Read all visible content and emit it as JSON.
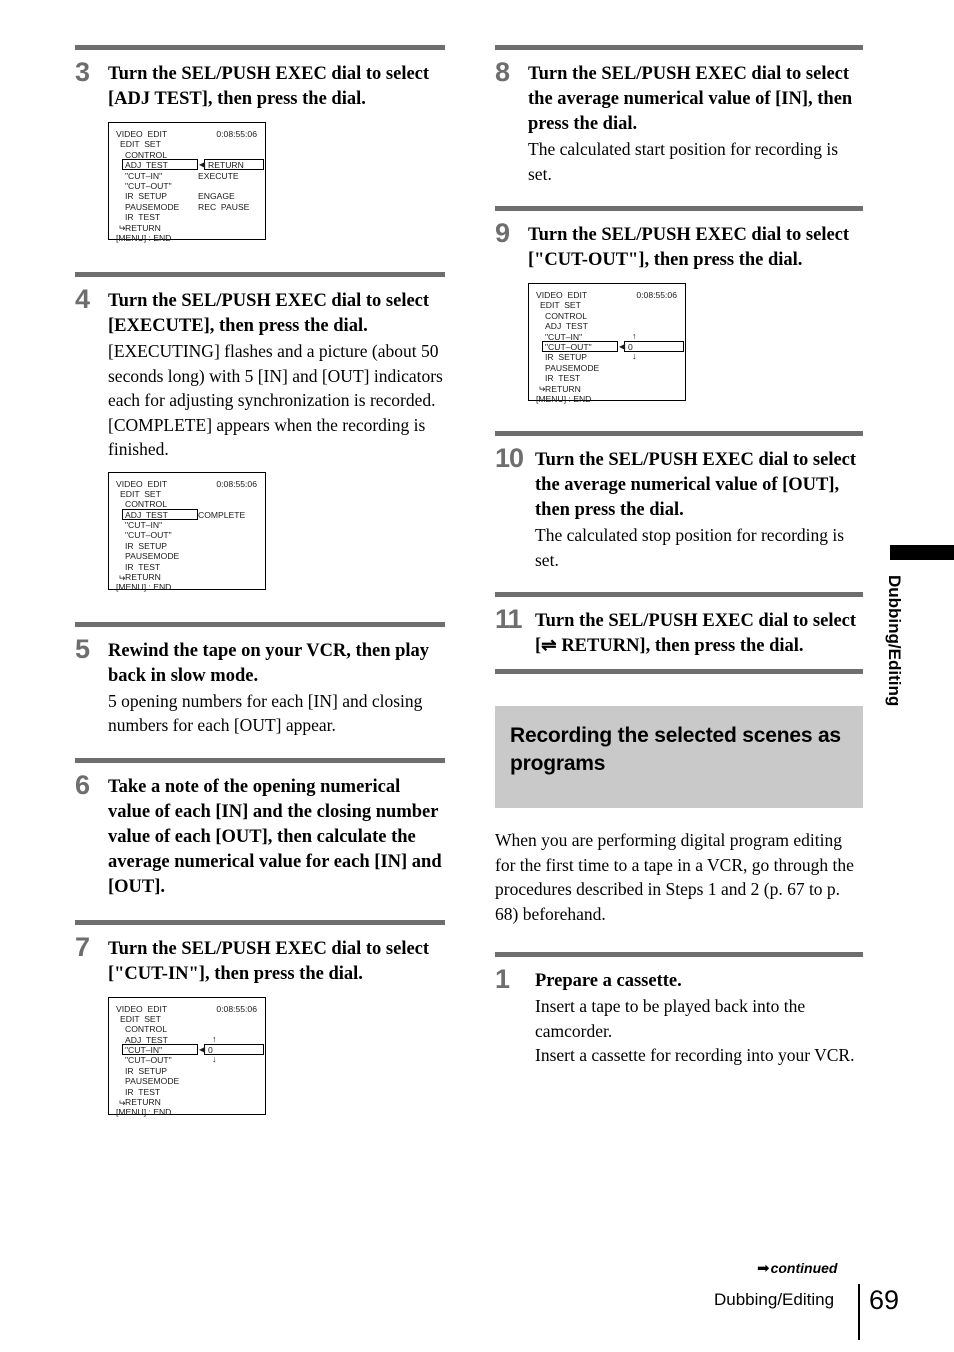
{
  "page": {
    "footer_section": "Dubbing/Editing",
    "page_number": "69",
    "continued_label": "continued",
    "continued_arrow": "➡",
    "side_tab_label": "Dubbing/Editing"
  },
  "left_column": {
    "steps": [
      {
        "number": "3",
        "title": "Turn the SEL/PUSH EXEC dial to select [ADJ TEST], then press the dial.",
        "body": ""
      },
      {
        "number": "4",
        "title": "Turn the SEL/PUSH EXEC dial to select [EXECUTE], then press the dial.",
        "body": "[EXECUTING] flashes and a picture (about 50 seconds long) with 5 [IN] and [OUT] indicators each for adjusting synchronization is recorded. [COMPLETE] appears when the recording is finished."
      },
      {
        "number": "5",
        "title": "Rewind the tape on your VCR, then play back in slow mode.",
        "body": "5 opening numbers for each [IN] and closing numbers for each [OUT] appear."
      },
      {
        "number": "6",
        "title": "Take a note of the opening numerical value of each [IN] and the closing number value of each [OUT], then calculate the average numerical value for each [IN] and [OUT].",
        "body": ""
      },
      {
        "number": "7",
        "title": "Turn the SEL/PUSH EXEC dial to select [\"CUT-IN\"], then press the dial.",
        "body": ""
      }
    ]
  },
  "right_column": {
    "steps": [
      {
        "number": "8",
        "title": "Turn the SEL/PUSH EXEC dial to select the average numerical value of [IN], then press the dial.",
        "body": "The calculated start position for recording is set."
      },
      {
        "number": "9",
        "title": "Turn the SEL/PUSH EXEC dial to select [\"CUT-OUT\"], then press the dial.",
        "body": ""
      },
      {
        "number": "10",
        "title": "Turn the SEL/PUSH EXEC dial to select the average numerical value of [OUT], then press the dial.",
        "body": "The calculated stop position for recording is set."
      },
      {
        "number": "11",
        "title_part1": "Turn the SEL/PUSH EXEC dial to select [",
        "return_glyph": "⇌",
        "title_part2": " RETURN], then press the dial.",
        "body": ""
      }
    ],
    "section": {
      "heading": "Recording the selected scenes as programs",
      "intro": "When you are performing digital program editing for the first time to a tape in a VCR, go through the procedures described in Steps 1 and 2 (p. 67 to p. 68) beforehand."
    },
    "sub_steps": [
      {
        "number": "1",
        "title": "Prepare a cassette.",
        "body_line1": "Insert a tape to be played back into the camcorder.",
        "body_line2": "Insert a cassette for recording into your VCR."
      }
    ]
  },
  "screens": {
    "adj_test_return": {
      "header_left": "VIDEO  EDIT",
      "header_right": "0:08:55:06",
      "rows": [
        {
          "label": "EDIT  SET",
          "indent": 1,
          "value": ""
        },
        {
          "label": "CONTROL",
          "indent": 2,
          "value": ""
        },
        {
          "label": "ADJ  TEST",
          "indent": 2,
          "value": "RETURN",
          "selected": true,
          "value_boxed": true,
          "left_arrow": true
        },
        {
          "label": "\"CUT–IN\"",
          "indent": 2,
          "value": "EXECUTE"
        },
        {
          "label": "\"CUT–OUT\"",
          "indent": 2,
          "value": ""
        },
        {
          "label": "IR  SETUP",
          "indent": 2,
          "value": "ENGAGE"
        },
        {
          "label": "PAUSEMODE",
          "indent": 2,
          "value": "REC  PAUSE"
        },
        {
          "label": "IR  TEST",
          "indent": 2,
          "value": ""
        },
        {
          "label": "RETURN",
          "indent": 2,
          "value": "",
          "return_arrow": true
        },
        {
          "label": "[MENU] : END",
          "indent": 0,
          "value": ""
        }
      ]
    },
    "adj_test_complete": {
      "header_left": "VIDEO  EDIT",
      "header_right": "0:08:55:06",
      "rows": [
        {
          "label": "EDIT  SET",
          "indent": 1,
          "value": ""
        },
        {
          "label": "CONTROL",
          "indent": 2,
          "value": ""
        },
        {
          "label": "ADJ  TEST",
          "indent": 2,
          "value": "COMPLETE",
          "selected": true
        },
        {
          "label": "\"CUT–IN\"",
          "indent": 2,
          "value": ""
        },
        {
          "label": "\"CUT–OUT\"",
          "indent": 2,
          "value": ""
        },
        {
          "label": "IR  SETUP",
          "indent": 2,
          "value": ""
        },
        {
          "label": "PAUSEMODE",
          "indent": 2,
          "value": ""
        },
        {
          "label": "IR  TEST",
          "indent": 2,
          "value": ""
        },
        {
          "label": "RETURN",
          "indent": 2,
          "value": "",
          "return_arrow": true
        },
        {
          "label": "[MENU] : END",
          "indent": 0,
          "value": ""
        }
      ]
    },
    "cut_in": {
      "header_left": "VIDEO  EDIT",
      "header_right": "0:08:55:06",
      "rows": [
        {
          "label": "EDIT  SET",
          "indent": 1,
          "value": ""
        },
        {
          "label": "CONTROL",
          "indent": 2,
          "value": ""
        },
        {
          "label": "ADJ  TEST",
          "indent": 2,
          "value": "",
          "up_arrow": true
        },
        {
          "label": "\"CUT–IN\"",
          "indent": 2,
          "value": "0",
          "selected": true,
          "value_boxed": true,
          "left_arrow": true
        },
        {
          "label": "\"CUT–OUT\"",
          "indent": 2,
          "value": "",
          "down_arrow": true
        },
        {
          "label": "IR  SETUP",
          "indent": 2,
          "value": ""
        },
        {
          "label": "PAUSEMODE",
          "indent": 2,
          "value": ""
        },
        {
          "label": "IR  TEST",
          "indent": 2,
          "value": ""
        },
        {
          "label": "RETURN",
          "indent": 2,
          "value": "",
          "return_arrow": true
        },
        {
          "label": "[MENU] : END",
          "indent": 0,
          "value": ""
        }
      ]
    },
    "cut_out": {
      "header_left": "VIDEO  EDIT",
      "header_right": "0:08:55:06",
      "rows": [
        {
          "label": "EDIT  SET",
          "indent": 1,
          "value": ""
        },
        {
          "label": "CONTROL",
          "indent": 2,
          "value": ""
        },
        {
          "label": "ADJ  TEST",
          "indent": 2,
          "value": ""
        },
        {
          "label": "\"CUT–IN\"",
          "indent": 2,
          "value": "",
          "up_arrow": true
        },
        {
          "label": "\"CUT–OUT\"",
          "indent": 2,
          "value": "0",
          "selected": true,
          "value_boxed": true,
          "left_arrow": true
        },
        {
          "label": "IR  SETUP",
          "indent": 2,
          "value": "",
          "down_arrow": true
        },
        {
          "label": "PAUSEMODE",
          "indent": 2,
          "value": ""
        },
        {
          "label": "IR  TEST",
          "indent": 2,
          "value": ""
        },
        {
          "label": "RETURN",
          "indent": 2,
          "value": "",
          "return_arrow": true
        },
        {
          "label": "[MENU] : END",
          "indent": 0,
          "value": ""
        }
      ]
    }
  }
}
